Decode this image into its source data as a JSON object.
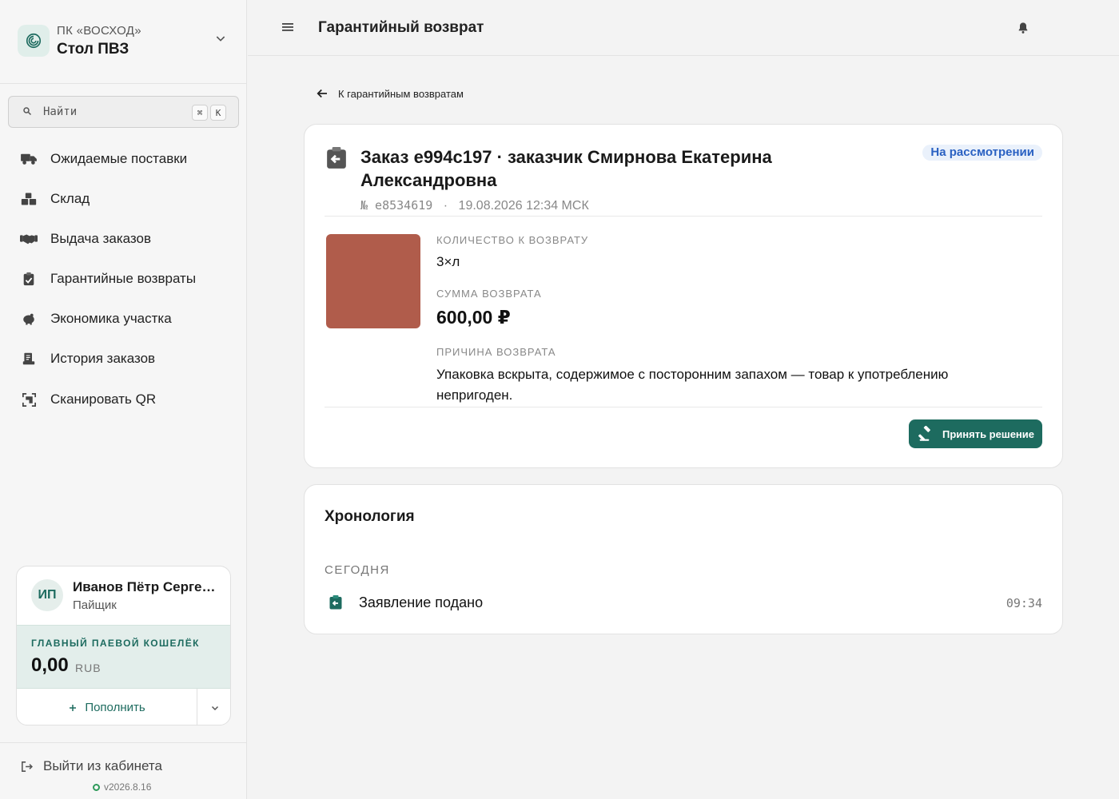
{
  "brand": {
    "org": "ПК «ВОСХОД»",
    "name": "Стол ПВЗ",
    "accent_color": "#1d6b5f"
  },
  "search": {
    "placeholder": "Найти",
    "shortcut_mod": "⌘",
    "shortcut_key": "K"
  },
  "nav": {
    "items": [
      {
        "label": "Ожидаемые поставки",
        "icon": "truck-icon"
      },
      {
        "label": "Склад",
        "icon": "boxes-icon"
      },
      {
        "label": "Выдача заказов",
        "icon": "handshake-icon"
      },
      {
        "label": "Гарантийные возвраты",
        "icon": "clipboard-return-icon"
      },
      {
        "label": "Экономика участка",
        "icon": "piggy-bank-icon"
      },
      {
        "label": "История заказов",
        "icon": "receipt-icon"
      },
      {
        "label": "Сканировать QR",
        "icon": "qr-scan-icon"
      }
    ]
  },
  "user": {
    "initials": "ИП",
    "name": "Иванов Пётр Сергеевич",
    "role": "Пайщик",
    "wallet_label": "ГЛАВНЫЙ ПАЕВОЙ КОШЕЛЁК",
    "wallet_amount": "0,00",
    "wallet_currency": "RUB",
    "topup_label": "Пополнить"
  },
  "footer": {
    "logout_label": "Выйти из кабинета",
    "version": "v2026.8.16"
  },
  "topbar": {
    "title": "Гарантийный возврат"
  },
  "back_link": {
    "label": "К гарантийным возвратам"
  },
  "claim": {
    "title": "Заказ e994c197 · заказчик Смирнова Екатерина Александровна",
    "number": "№ e8534619",
    "separator": "·",
    "date": "19.08.2026 12:34 МСК",
    "status": "На рассмотрении",
    "status_color": "#2a61c2",
    "qty_label": "КОЛИЧЕСТВО К ВОЗВРАТУ",
    "qty_value": "3×л",
    "sum_label": "СУММА ВОЗВРАТА",
    "sum_value": "600,00 ₽",
    "reason_label": "ПРИЧИНА ВОЗВРАТА",
    "reason_value": "Упаковка вскрыта, содержимое с посторонним запахом — товар к употреблению непригоден.",
    "decision_label": "Принять решение",
    "product_color": "#b05c4b"
  },
  "timeline": {
    "title": "Хронология",
    "group_label": "СЕГОДНЯ",
    "events": [
      {
        "label": "Заявление подано",
        "time": "09:34"
      }
    ]
  }
}
